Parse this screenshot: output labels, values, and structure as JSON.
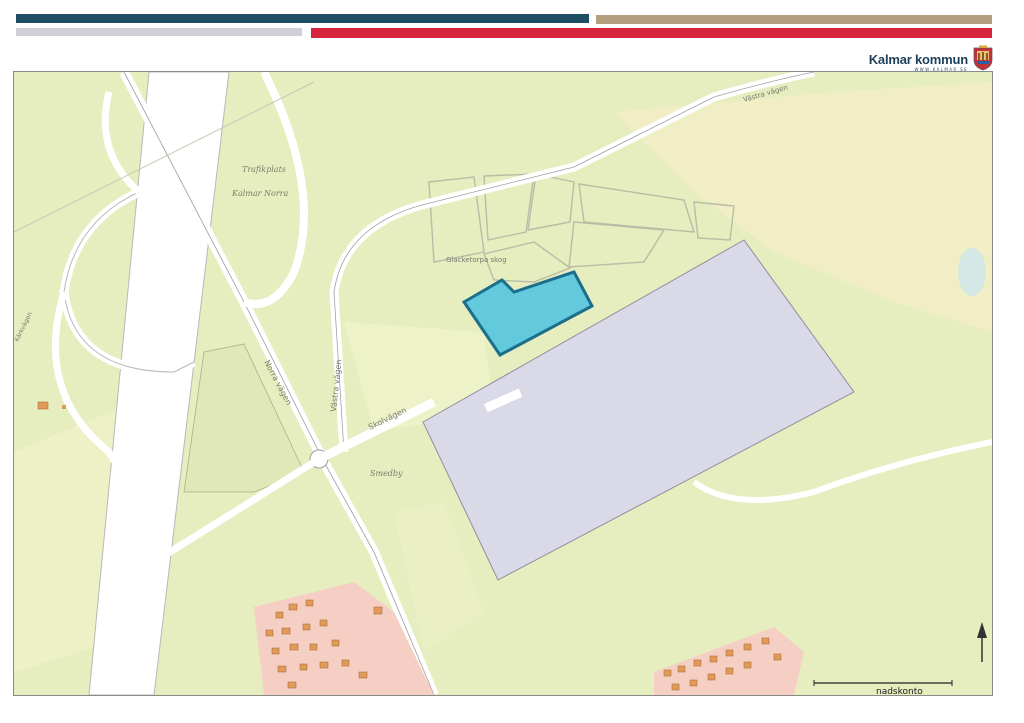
{
  "header": {
    "brand_name": "Kalmar kommun",
    "brand_url": "WWW.KALMAR.SE",
    "colors": {
      "navy": "#1e4e63",
      "tan": "#b49f80",
      "grey": "#cfd0d6",
      "red": "#d5243c"
    },
    "crest_icon": "kalmar-coat-of-arms"
  },
  "map": {
    "colors": {
      "land": "#e6edbf",
      "field": "#f2eec2",
      "road": "#ffffff",
      "industrial_area": "#d9d9e8",
      "highlight_parcel": "#63c9dc",
      "highlight_border": "#1c6f8c",
      "residential": "#f5cfc4",
      "building": "#e09a5a"
    },
    "labels": {
      "trafikplats_1": "Trafikplats",
      "trafikplats_2": "Kalmar Norra",
      "vag_1": "Norra vägen",
      "vag_2": "Västra vägen",
      "vag_3": "Skolvägen",
      "area_1": "Smedby",
      "road_top": "Västra vägen",
      "label_left_1": "Kärkvägen",
      "place_north": "Glacketorpa skog",
      "scale_text": "nadskonto"
    },
    "icons": {
      "north_arrow": "north-arrow-icon",
      "scale_bar": "scale-bar"
    }
  }
}
